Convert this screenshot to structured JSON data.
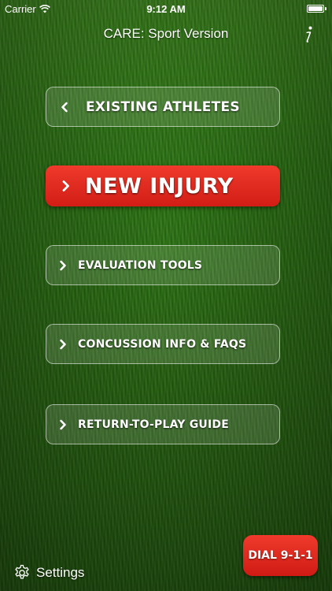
{
  "status_bar": {
    "carrier": "Carrier",
    "time": "9:12 AM"
  },
  "nav": {
    "title": "CARE: Sport Version",
    "info_icon": "info-icon"
  },
  "menu": {
    "existing_athletes": "EXISTING ATHLETES",
    "new_injury": "NEW INJURY",
    "evaluation_tools": "EVALUATION TOOLS",
    "concussion_info": "CONCUSSION INFO & FAQS",
    "return_to_play": "RETURN-TO-PLAY GUIDE"
  },
  "footer": {
    "settings_label": "Settings",
    "dial_label": "DIAL 9-1-1"
  },
  "colors": {
    "accent_red": "#e02a20",
    "grass_green": "#2f7a16"
  }
}
